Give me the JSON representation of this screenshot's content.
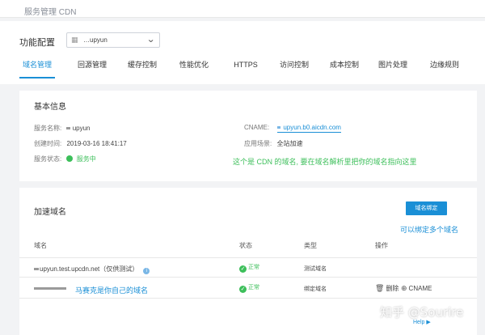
{
  "topbar": {
    "breadcrumb": "服务管理 CDN"
  },
  "config": {
    "label": "功能配置",
    "service_select": {
      "value": "…upyun",
      "icon": "service-icon"
    }
  },
  "tabs": [
    {
      "label": "域名管理",
      "active": true
    },
    {
      "label": "回源管理"
    },
    {
      "label": "缓存控制"
    },
    {
      "label": "性能优化"
    },
    {
      "label": "HTTPS"
    },
    {
      "label": "访问控制"
    },
    {
      "label": "成本控制"
    },
    {
      "label": "图片处理"
    },
    {
      "label": "边缘规则"
    }
  ],
  "basic": {
    "title": "基本信息",
    "service_name_label": "服务名称:",
    "service_name_value": "upyun",
    "created_label": "创建时间:",
    "created_value": "2019-03-16 18:41:17",
    "status_label": "服务状态:",
    "status_value": "服务中",
    "cname_label": "CNAME:",
    "cname_value": "upyun.b0.aicdn.com",
    "scene_label": "应用场景:",
    "scene_value": "全站加速",
    "annotation": "这个是 CDN 的域名, 要在域名解析里把你的域名指向这里"
  },
  "domains": {
    "title": "加速域名",
    "bind_button": "域名绑定",
    "annotation": "可以绑定多个域名",
    "columns": [
      "域名",
      "状态",
      "类型",
      "操作"
    ],
    "rows": [
      {
        "domain": "upyun.test.upcdn.net（仅供测试）",
        "status": "正常",
        "type": "测试域名"
      },
      {
        "domain_annotation": "马赛克是你自己的域名",
        "status": "正常",
        "type": "绑定域名",
        "actions": [
          "删除",
          "CNAME"
        ]
      }
    ]
  },
  "watermark": "知乎 @Sourire",
  "help": "Help ▶",
  "colors": {
    "accent": "#1a8fd6",
    "success": "#3cbf5a"
  }
}
